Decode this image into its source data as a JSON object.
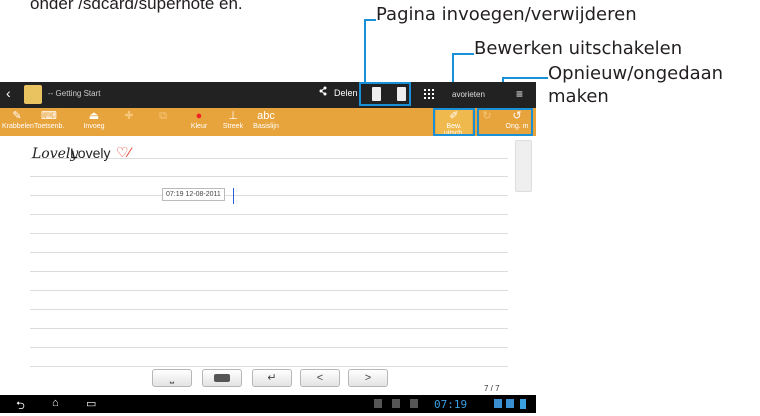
{
  "intro_text": "onder /sdcard/supernote en.",
  "callouts": {
    "page": "Pagina invoegen/verwijderen",
    "edit": "Bewerken uitschakelen",
    "undo": "Opnieuw/ongedaan",
    "undo2": "maken"
  },
  "accent_color": "#1a90d6",
  "app": {
    "title": "-- Getting Start",
    "share": "Delen",
    "favorites": "avorieten"
  },
  "toolbar": {
    "scribble": "Krabbelen",
    "keyboard": "Toetsenb.",
    "insert": "Invoeg",
    "color": "Kleur",
    "stroke": "Streek",
    "baseline": "Basislijn",
    "disable_edit": "Bew. uitsch.",
    "undo": "Ong. m"
  },
  "note": {
    "handwriting": "Lovely",
    "typed": "Lovely",
    "timestamp": "07:19 12-08-2011"
  },
  "page_count": "7 / 7",
  "status": {
    "time": "07:19"
  }
}
